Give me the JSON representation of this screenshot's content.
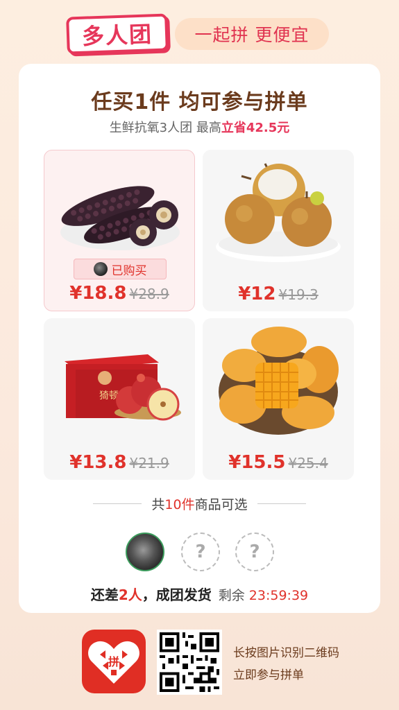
{
  "header": {
    "brand": "多人团",
    "slogan": "一起拼 更便宜"
  },
  "card": {
    "title": "任买1件 均可参与拼单",
    "subtitle_prefix": "生鲜抗氧3人团 最高",
    "subtitle_highlight": "立省42.5元"
  },
  "products": [
    {
      "name_icon": "purple-corn-image",
      "price": "¥18.8",
      "old_price": "¥28.9",
      "bought_label": "已购买"
    },
    {
      "name_icon": "pear-image",
      "price": "¥12",
      "old_price": "¥19.3"
    },
    {
      "name_icon": "apple-box-image",
      "price": "¥13.8",
      "old_price": "¥21.9",
      "box_text": "猗顿农品"
    },
    {
      "name_icon": "mango-image",
      "price": "¥15.5",
      "old_price": "¥25.4"
    }
  ],
  "divider": {
    "prefix": "共",
    "count": "10件",
    "suffix": "商品可选"
  },
  "group": {
    "empty_mark": "?",
    "status_a": "还差",
    "status_num": "2人",
    "status_b": "，成团发货",
    "remaining_label": "剩余",
    "timer": "23:59:39"
  },
  "footer": {
    "logo_char": "拼",
    "line1": "长按图片识别二维码",
    "line2": "立即参与拼单"
  },
  "colors": {
    "accent_red": "#e0322b",
    "brand_pink": "#e6365a",
    "title_brown": "#6b3b1d"
  }
}
